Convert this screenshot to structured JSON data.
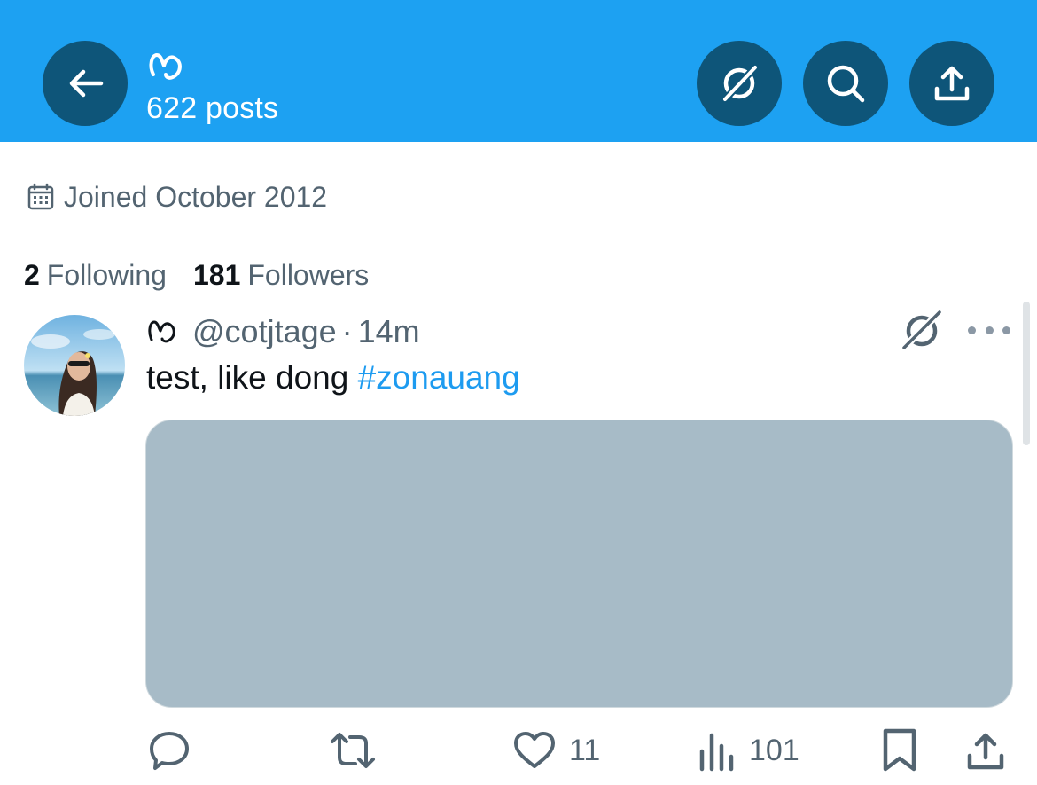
{
  "header": {
    "posts_label": "622 posts",
    "background_color": "#1da1f2",
    "button_color": "#0e5579"
  },
  "profile": {
    "joined": "Joined October 2012",
    "following_count": "2",
    "following_label": "Following",
    "followers_count": "181",
    "followers_label": "Followers"
  },
  "tweet": {
    "handle": "@cotjtage",
    "separator": "·",
    "time": "14m",
    "text": "test, like dong",
    "hashtag": "#zonauang",
    "likes": "11",
    "views": "101",
    "media_color": "#a7bbc7"
  },
  "icons": {
    "back": "arrow-left-icon",
    "grok": "grok-icon",
    "search": "search-icon",
    "share": "share-icon",
    "calendar": "calendar-icon",
    "reply": "reply-icon",
    "retweet": "retweet-icon",
    "like": "heart-icon",
    "views": "views-icon",
    "bookmark": "bookmark-icon",
    "more": "more-icon"
  }
}
